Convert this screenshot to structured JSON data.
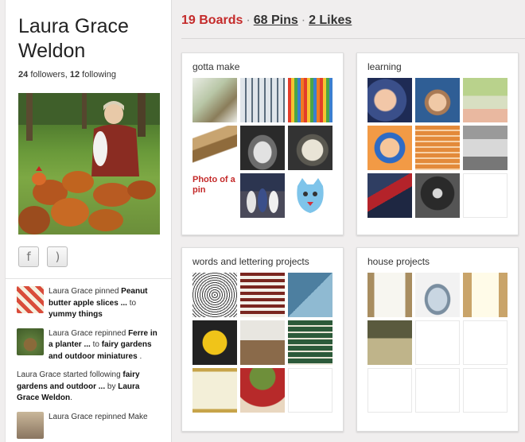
{
  "profile": {
    "name": "Laura Grace Weldon",
    "followers_count": "24",
    "followers_label": "followers",
    "following_count": "12",
    "following_label": "following"
  },
  "stats": {
    "boards": "19 Boards",
    "pins": "68 Pins",
    "likes": "2 Likes"
  },
  "social": {
    "facebook_icon": "facebook-icon",
    "rss_icon": "rss-icon"
  },
  "activity": [
    {
      "actor": "Laura Grace pinned ",
      "object": "Peanut butter apple slices ...",
      "mid": " to ",
      "target": "yummy things",
      "end": ""
    },
    {
      "actor": "Laura Grace repinned ",
      "object": "Ferre in a planter ...",
      "mid": " to ",
      "target": "fairy gardens and outdoor miniatures",
      "end": " ."
    },
    {
      "actor": "Laura Grace started following ",
      "object": "fairy gardens and outdoor ...",
      "mid": " by ",
      "target": "Laura Grace Weldon",
      "end": "."
    },
    {
      "actor": "Laura Grace repinned Make",
      "object": "",
      "mid": "",
      "target": "",
      "end": ""
    }
  ],
  "boards": [
    {
      "title": "gotta make",
      "placeholder_text": "Photo of a pin"
    },
    {
      "title": "learning"
    },
    {
      "title": "words and lettering projects"
    },
    {
      "title": "house projects"
    }
  ],
  "colors": {
    "accent_red": "#c42a2a",
    "page_bg": "#f0eeee"
  }
}
